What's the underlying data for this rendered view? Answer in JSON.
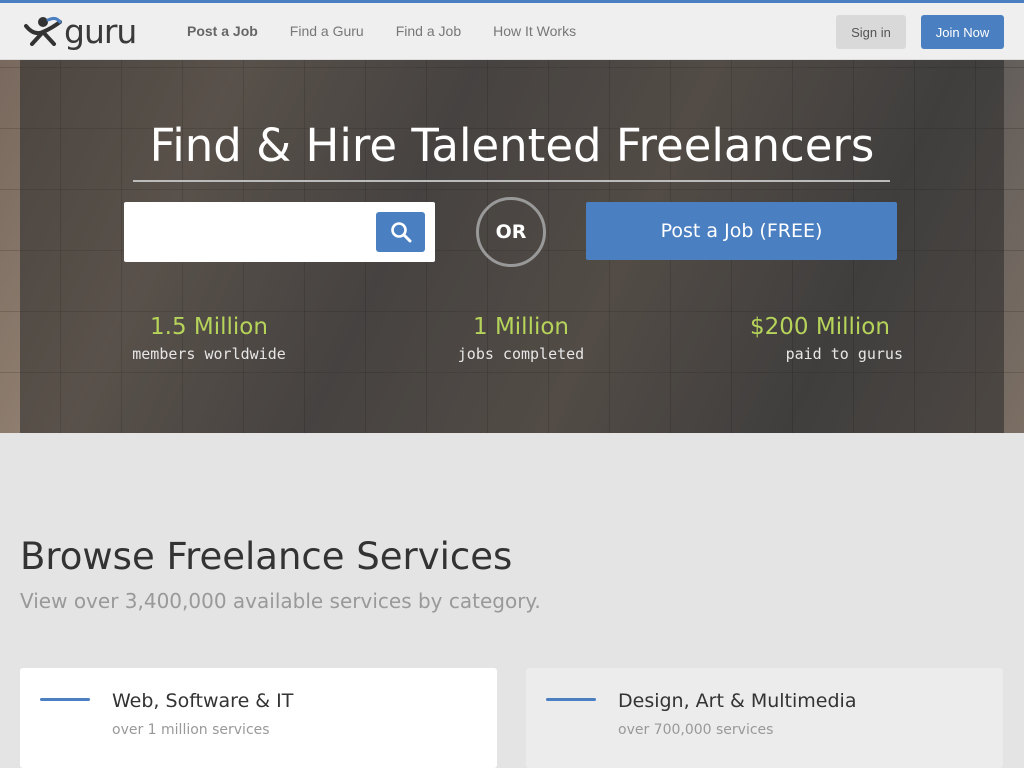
{
  "brand": {
    "logo_text": "guru"
  },
  "nav": {
    "post_job": "Post a Job",
    "find_guru": "Find a Guru",
    "find_job": "Find a Job",
    "how_it_works": "How It Works"
  },
  "auth": {
    "sign_in": "Sign in",
    "join_now": "Join Now"
  },
  "hero": {
    "title": "Find & Hire Talented Freelancers",
    "search_value": "",
    "or_label": "OR",
    "post_job_free": "Post a Job (FREE)",
    "stats": [
      {
        "value": "1.5 Million",
        "label": "members worldwide"
      },
      {
        "value": "1 Million",
        "label": "jobs completed"
      },
      {
        "value": "$200 Million",
        "label": "paid to gurus"
      }
    ]
  },
  "browse": {
    "title": "Browse Freelance Services",
    "subtitle": "View over 3,400,000 available services by category.",
    "categories": [
      {
        "name": "Web, Software & IT",
        "count": "over 1 million services"
      },
      {
        "name": "Design, Art & Multimedia",
        "count": "over 700,000 services"
      }
    ]
  },
  "colors": {
    "accent": "#4a7fc1",
    "stat_green": "#b6d35a"
  }
}
